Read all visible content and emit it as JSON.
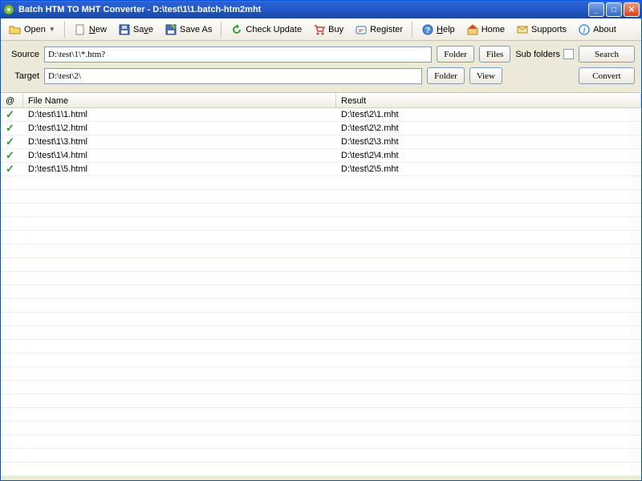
{
  "window": {
    "title": "Batch HTM TO MHT Converter - D:\\test\\1\\1.batch-htm2mht"
  },
  "toolbar": {
    "open": "Open",
    "new": "New",
    "save": "Save",
    "saveas": "Save As",
    "check": "Check Update",
    "buy": "Buy",
    "register": "Register",
    "help": "Help",
    "home": "Home",
    "supports": "Supports",
    "about": "About"
  },
  "paths": {
    "source_label": "Source",
    "source_value": "D:\\test\\1\\*.htm?",
    "target_label": "Target",
    "target_value": "D:\\test\\2\\",
    "folder_btn": "Folder",
    "files_btn": "Files",
    "view_btn": "View",
    "subfolders_label": "Sub folders",
    "search_btn": "Search",
    "convert_btn": "Convert"
  },
  "list": {
    "col_at": "@",
    "col_filename": "File Name",
    "col_result": "Result",
    "rows": [
      {
        "file": "D:\\test\\1\\1.html",
        "result": "D:\\test\\2\\1.mht"
      },
      {
        "file": "D:\\test\\1\\2.html",
        "result": "D:\\test\\2\\2.mht"
      },
      {
        "file": "D:\\test\\1\\3.html",
        "result": "D:\\test\\2\\3.mht"
      },
      {
        "file": "D:\\test\\1\\4.html",
        "result": "D:\\test\\2\\4.mht"
      },
      {
        "file": "D:\\test\\1\\5.html",
        "result": "D:\\test\\2\\5.mht"
      }
    ]
  }
}
